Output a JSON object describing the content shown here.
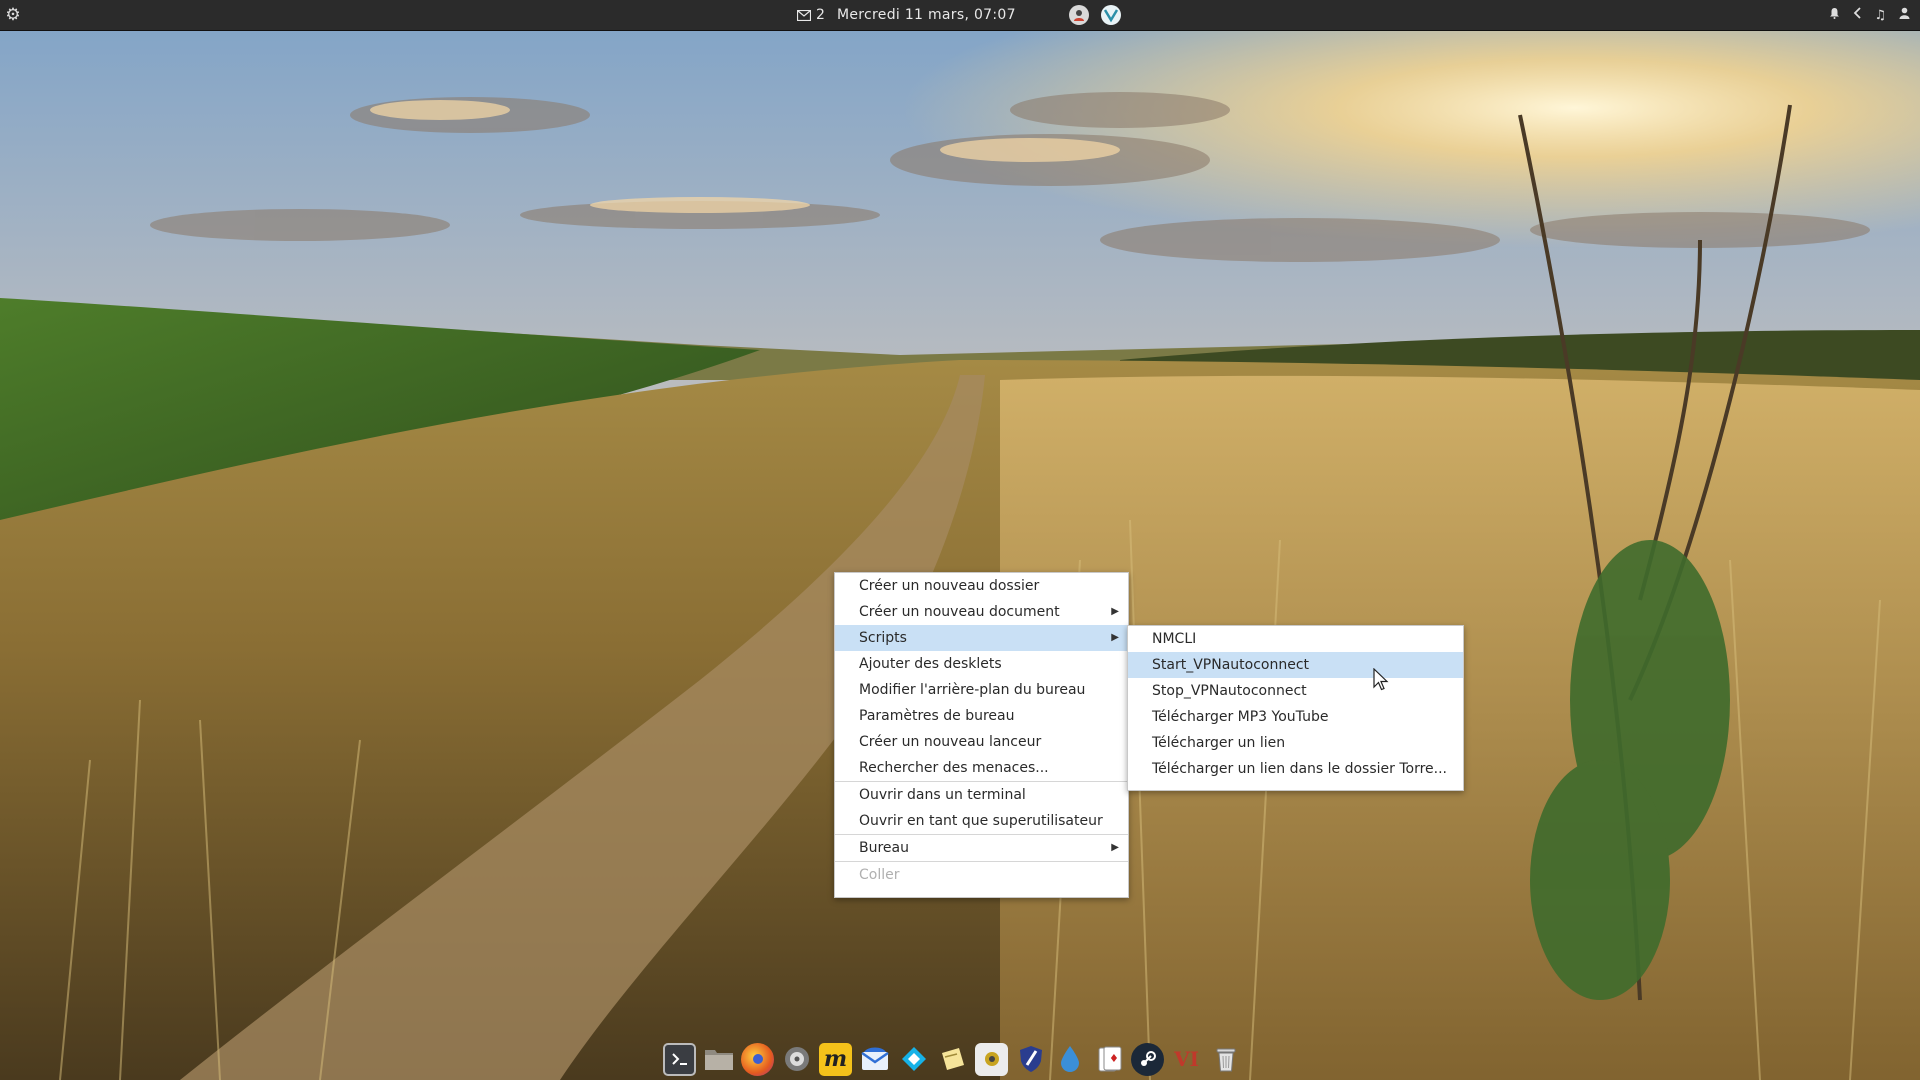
{
  "top_panel": {
    "mail_count": "2",
    "clock": "Mercredi 11 mars, 07:07",
    "icons": [
      "menu-gear-icon",
      "mail-icon",
      "user-app-icon",
      "vpn-app-icon",
      "bell-icon",
      "volume-icon",
      "music-icon",
      "user-icon"
    ]
  },
  "context_menu": {
    "items": [
      {
        "label": "Créer un nouveau dossier"
      },
      {
        "label": "Créer un nouveau document"
      },
      {
        "label": "Scripts"
      },
      {
        "label": "Ajouter des desklets"
      },
      {
        "label": "Modifier l'arrière-plan du bureau"
      },
      {
        "label": "Paramètres de bureau"
      },
      {
        "label": "Créer un nouveau lanceur"
      },
      {
        "label": "Rechercher des menaces..."
      },
      {
        "label": "Ouvrir dans un terminal"
      },
      {
        "label": "Ouvrir en tant que superutilisateur"
      },
      {
        "label": "Bureau"
      },
      {
        "label": "Coller"
      }
    ],
    "highlighted": "Scripts"
  },
  "submenu": {
    "items": [
      {
        "label": "NMCLI"
      },
      {
        "label": "Start_VPNautoconnect"
      },
      {
        "label": "Stop_VPNautoconnect"
      },
      {
        "label": "Télécharger MP3 YouTube"
      },
      {
        "label": "Télécharger un lien"
      },
      {
        "label": "Télécharger un lien dans le dossier Torre..."
      }
    ],
    "highlighted": "Start_VPNautoconnect"
  },
  "dock": {
    "apps": [
      "terminal-icon",
      "files-icon",
      "firefox-icon",
      "disk-utility-icon",
      "mailspring-icon",
      "thunderbird-icon",
      "kodi-icon",
      "notes-icon",
      "scanner-icon",
      "security-shield-icon",
      "vpn-drop-icon",
      "solitaire-icon",
      "steam-icon",
      "vi-editor-icon",
      "trash-icon"
    ],
    "glyphs": {
      "mailspring": "m",
      "vi": "VI"
    }
  },
  "colors": {
    "panel": "#2b2b2b",
    "menu_highlight": "#c9e0f5",
    "menu_bg": "#ffffff"
  }
}
